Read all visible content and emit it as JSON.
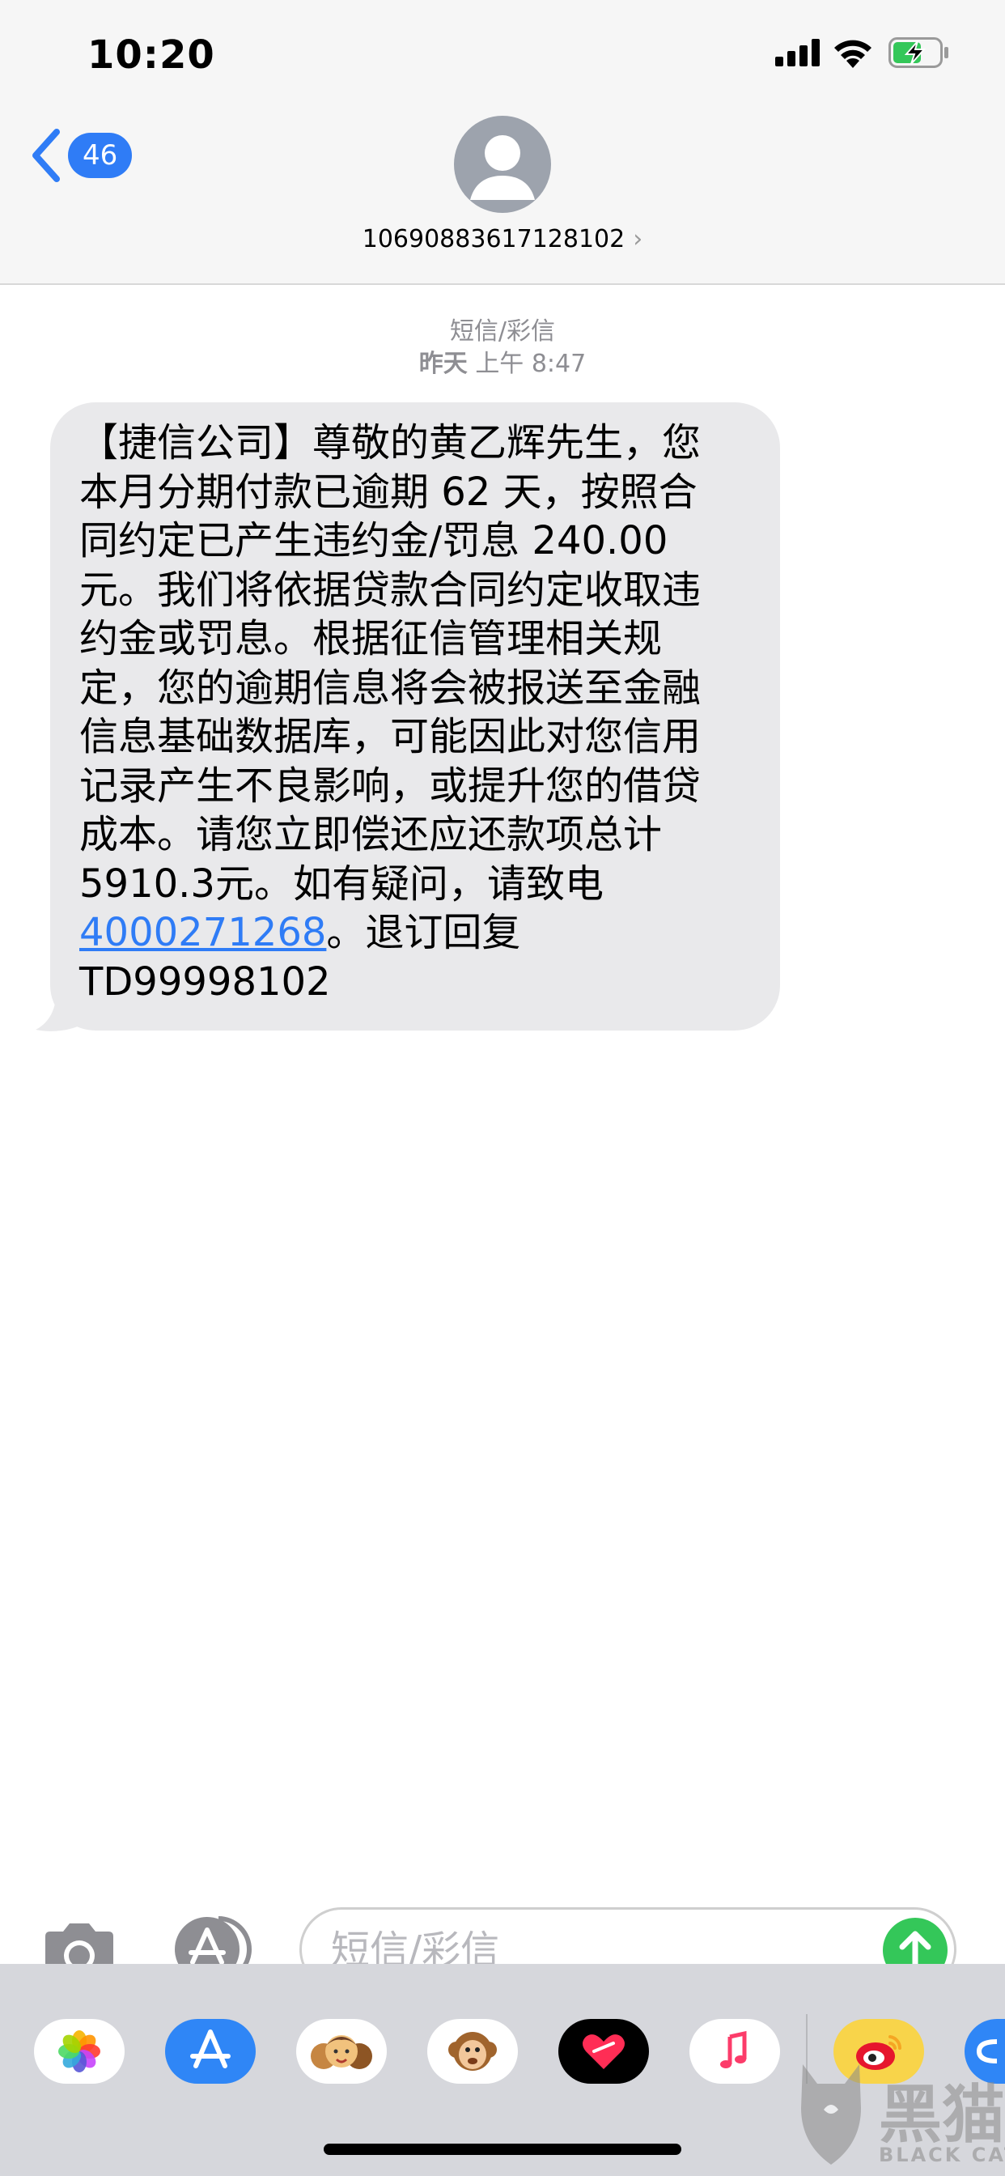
{
  "status_bar": {
    "time": "10:20"
  },
  "header": {
    "back_count": "46",
    "contact_number": "10690883617128102"
  },
  "conversation": {
    "service_label": "短信/彩信",
    "timestamp_day": "昨天",
    "timestamp_time": "上午 8:47",
    "message_lines": [
      "【捷信公司】尊敬的黄乙辉先生，您",
      "本月分期付款已逾期 62 天，按照合",
      "同约定已产生违约金/罚息 240.00",
      "元。我们将依据贷款合同约定收取违",
      "约金或罚息。根据征信管理相关规",
      "定，您的逾期信息将会被报送至金融",
      "信息基础数据库，可能因此对您信用",
      "记录产生不良影响，或提升您的借贷",
      "成本。请您立即偿还应还款项总计",
      "5910.3元。如有疑问，请致电"
    ],
    "phone_link": "4000271268",
    "after_link": "。退订回复",
    "last_line": "TD99998102"
  },
  "input_bar": {
    "placeholder": "短信/彩信"
  },
  "app_drawer": {
    "apps": [
      "photos-app",
      "app-store-app",
      "memoji-app",
      "animoji-app",
      "digital-touch-app",
      "music-app",
      "weibo-app",
      "partial-app"
    ]
  },
  "watermark": {
    "cn": "黑猫",
    "en": "BLACK CAT"
  },
  "colors": {
    "accent_blue": "#2f7cf6",
    "bubble_gray": "#e9e9eb",
    "send_green": "#34c759",
    "header_bg": "#f6f6f6",
    "drawer_bg": "#d6d7dc"
  }
}
